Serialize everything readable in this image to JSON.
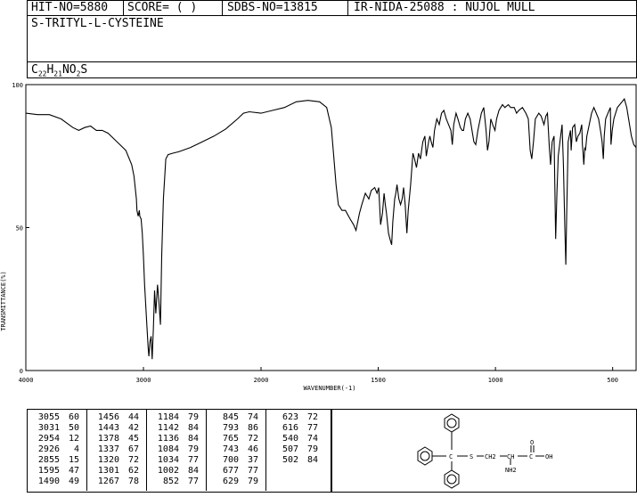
{
  "header": {
    "hit_no": "HIT-NO=5880",
    "score": "SCORE=  (   )",
    "sdbs_no": "SDBS-NO=13815",
    "ir_info": "IR-NIDA-25088 : NUJOL MULL"
  },
  "compound": {
    "name": "S-TRITYL-L-CYSTEINE",
    "formula": "C22H21NO2S"
  },
  "chart_data": {
    "type": "line",
    "title": "",
    "xlabel": "WAVENUMBER(-1)",
    "ylabel": "TRANSMITTANCE(%)",
    "xlim": [
      4000,
      400
    ],
    "ylim": [
      0,
      100
    ],
    "x_ticks": [
      "4000",
      "3000",
      "2000",
      "1500",
      "1000",
      "500"
    ],
    "y_ticks": [
      "100",
      "50",
      "0"
    ],
    "series": [
      {
        "points": [
          [
            4000,
            90
          ],
          [
            3900,
            89.5
          ],
          [
            3800,
            89.5
          ],
          [
            3700,
            88
          ],
          [
            3600,
            85
          ],
          [
            3550,
            84
          ],
          [
            3500,
            85
          ],
          [
            3450,
            85.5
          ],
          [
            3400,
            84
          ],
          [
            3350,
            84
          ],
          [
            3300,
            83
          ],
          [
            3250,
            81
          ],
          [
            3200,
            79
          ],
          [
            3150,
            77
          ],
          [
            3100,
            72
          ],
          [
            3080,
            68
          ],
          [
            3060,
            60
          ],
          [
            3055,
            56
          ],
          [
            3045,
            54
          ],
          [
            3035,
            56
          ],
          [
            3031,
            54
          ],
          [
            3020,
            53
          ],
          [
            3010,
            48
          ],
          [
            3000,
            40
          ],
          [
            2990,
            30
          ],
          [
            2970,
            15
          ],
          [
            2960,
            8
          ],
          [
            2954,
            5
          ],
          [
            2945,
            10
          ],
          [
            2935,
            12
          ],
          [
            2926,
            4
          ],
          [
            2915,
            15
          ],
          [
            2905,
            28
          ],
          [
            2895,
            20
          ],
          [
            2880,
            30
          ],
          [
            2870,
            25
          ],
          [
            2855,
            16
          ],
          [
            2845,
            40
          ],
          [
            2830,
            60
          ],
          [
            2810,
            74
          ],
          [
            2790,
            75.5
          ],
          [
            2750,
            76
          ],
          [
            2700,
            76.5
          ],
          [
            2600,
            78
          ],
          [
            2500,
            80
          ],
          [
            2400,
            82
          ],
          [
            2300,
            84.5
          ],
          [
            2200,
            88
          ],
          [
            2150,
            90
          ],
          [
            2100,
            90.5
          ],
          [
            2000,
            90
          ],
          [
            1950,
            91
          ],
          [
            1900,
            92
          ],
          [
            1850,
            94
          ],
          [
            1800,
            94.5
          ],
          [
            1750,
            94
          ],
          [
            1720,
            92
          ],
          [
            1700,
            85
          ],
          [
            1690,
            75
          ],
          [
            1680,
            65
          ],
          [
            1670,
            58
          ],
          [
            1655,
            56
          ],
          [
            1640,
            56
          ],
          [
            1620,
            53
          ],
          [
            1605,
            51
          ],
          [
            1595,
            49
          ],
          [
            1580,
            55
          ],
          [
            1570,
            58
          ],
          [
            1555,
            62
          ],
          [
            1540,
            60
          ],
          [
            1530,
            63
          ],
          [
            1515,
            64
          ],
          [
            1505,
            62
          ],
          [
            1498,
            64
          ],
          [
            1490,
            51
          ],
          [
            1482,
            55
          ],
          [
            1475,
            62
          ],
          [
            1470,
            58
          ],
          [
            1465,
            55
          ],
          [
            1456,
            48
          ],
          [
            1450,
            46
          ],
          [
            1443,
            44
          ],
          [
            1438,
            52
          ],
          [
            1430,
            60
          ],
          [
            1425,
            62
          ],
          [
            1420,
            65
          ],
          [
            1412,
            60
          ],
          [
            1405,
            58
          ],
          [
            1398,
            60
          ],
          [
            1392,
            64
          ],
          [
            1385,
            58
          ],
          [
            1378,
            48
          ],
          [
            1372,
            56
          ],
          [
            1362,
            65
          ],
          [
            1352,
            76
          ],
          [
            1345,
            74
          ],
          [
            1337,
            71
          ],
          [
            1328,
            76
          ],
          [
            1320,
            74
          ],
          [
            1310,
            80
          ],
          [
            1301,
            82
          ],
          [
            1295,
            75
          ],
          [
            1285,
            80
          ],
          [
            1280,
            82
          ],
          [
            1274,
            80
          ],
          [
            1267,
            78
          ],
          [
            1260,
            84
          ],
          [
            1250,
            88
          ],
          [
            1240,
            86
          ],
          [
            1230,
            90
          ],
          [
            1220,
            91
          ],
          [
            1210,
            88
          ],
          [
            1200,
            86
          ],
          [
            1190,
            84
          ],
          [
            1184,
            79
          ],
          [
            1178,
            86
          ],
          [
            1168,
            90
          ],
          [
            1160,
            88
          ],
          [
            1150,
            85
          ],
          [
            1142,
            84
          ],
          [
            1136,
            84
          ],
          [
            1128,
            88
          ],
          [
            1118,
            90
          ],
          [
            1108,
            88
          ],
          [
            1100,
            84
          ],
          [
            1092,
            80
          ],
          [
            1084,
            79
          ],
          [
            1075,
            84
          ],
          [
            1060,
            90
          ],
          [
            1050,
            92
          ],
          [
            1040,
            84
          ],
          [
            1034,
            77
          ],
          [
            1028,
            80
          ],
          [
            1020,
            88
          ],
          [
            1012,
            86
          ],
          [
            1002,
            84
          ],
          [
            995,
            88
          ],
          [
            985,
            91
          ],
          [
            970,
            93
          ],
          [
            960,
            92
          ],
          [
            945,
            93
          ],
          [
            935,
            92
          ],
          [
            920,
            92
          ],
          [
            910,
            90
          ],
          [
            900,
            91
          ],
          [
            885,
            92
          ],
          [
            870,
            90
          ],
          [
            860,
            88
          ],
          [
            852,
            77
          ],
          [
            845,
            74
          ],
          [
            838,
            80
          ],
          [
            830,
            88
          ],
          [
            815,
            90
          ],
          [
            805,
            89
          ],
          [
            793,
            86
          ],
          [
            785,
            89
          ],
          [
            778,
            90
          ],
          [
            770,
            78
          ],
          [
            765,
            72
          ],
          [
            758,
            80
          ],
          [
            750,
            82
          ],
          [
            743,
            46
          ],
          [
            738,
            62
          ],
          [
            732,
            75
          ],
          [
            725,
            80
          ],
          [
            716,
            86
          ],
          [
            710,
            72
          ],
          [
            704,
            50
          ],
          [
            700,
            37
          ],
          [
            696,
            55
          ],
          [
            690,
            80
          ],
          [
            680,
            84
          ],
          [
            677,
            77
          ],
          [
            671,
            85
          ],
          [
            662,
            86
          ],
          [
            655,
            80
          ],
          [
            648,
            82
          ],
          [
            640,
            83
          ],
          [
            632,
            86
          ],
          [
            629,
            79
          ],
          [
            626,
            76
          ],
          [
            623,
            72
          ],
          [
            619,
            78
          ],
          [
            616,
            77
          ],
          [
            610,
            82
          ],
          [
            600,
            86
          ],
          [
            590,
            90
          ],
          [
            580,
            92
          ],
          [
            570,
            90
          ],
          [
            560,
            88
          ],
          [
            550,
            83
          ],
          [
            545,
            80
          ],
          [
            540,
            74
          ],
          [
            536,
            82
          ],
          [
            530,
            88
          ],
          [
            520,
            90
          ],
          [
            510,
            92
          ],
          [
            507,
            79
          ],
          [
            502,
            84
          ],
          [
            495,
            88
          ],
          [
            480,
            92
          ],
          [
            470,
            93
          ],
          [
            460,
            94
          ],
          [
            450,
            95
          ],
          [
            440,
            92
          ],
          [
            430,
            87
          ],
          [
            420,
            82
          ],
          [
            410,
            79
          ],
          [
            400,
            78
          ]
        ]
      }
    ]
  },
  "peak_table": [
    [
      [
        "3055",
        "60"
      ],
      [
        "3031",
        "50"
      ],
      [
        "2954",
        "12"
      ],
      [
        "2926",
        "4"
      ],
      [
        "2855",
        "15"
      ],
      [
        "1595",
        "47"
      ],
      [
        "1490",
        "49"
      ]
    ],
    [
      [
        "1456",
        "44"
      ],
      [
        "1443",
        "42"
      ],
      [
        "1378",
        "45"
      ],
      [
        "1337",
        "67"
      ],
      [
        "1320",
        "72"
      ],
      [
        "1301",
        "62"
      ],
      [
        "1267",
        "78"
      ]
    ],
    [
      [
        "1184",
        "79"
      ],
      [
        "1142",
        "84"
      ],
      [
        "1136",
        "84"
      ],
      [
        "1084",
        "79"
      ],
      [
        "1034",
        "77"
      ],
      [
        "1002",
        "84"
      ],
      [
        "852",
        "77"
      ]
    ],
    [
      [
        "845",
        "74"
      ],
      [
        "793",
        "86"
      ],
      [
        "765",
        "72"
      ],
      [
        "743",
        "46"
      ],
      [
        "700",
        "37"
      ],
      [
        "677",
        "77"
      ],
      [
        "629",
        "79"
      ]
    ],
    [
      [
        "623",
        "72"
      ],
      [
        "616",
        "77"
      ],
      [
        "540",
        "74"
      ],
      [
        "507",
        "79"
      ],
      [
        "502",
        "84"
      ]
    ]
  ],
  "structure": {
    "labels": {
      "s": "S",
      "ch2": "CH2",
      "ch": "CH",
      "nh2": "NH2",
      "c": "C",
      "o": "O",
      "oh": "OH"
    }
  }
}
